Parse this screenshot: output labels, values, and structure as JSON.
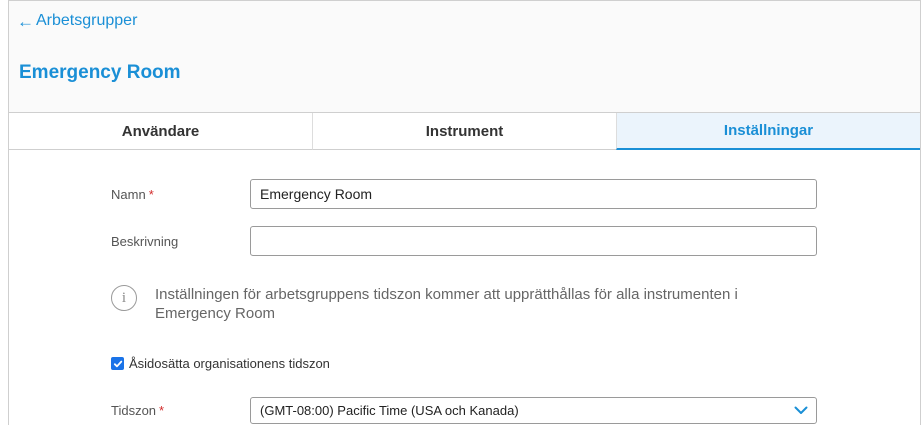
{
  "header": {
    "back_arrow": "←",
    "back_label": "Arbetsgrupper",
    "title": "Emergency Room"
  },
  "tabs": [
    {
      "label": "Användare",
      "active": false
    },
    {
      "label": "Instrument",
      "active": false
    },
    {
      "label": "Inställningar",
      "active": true
    }
  ],
  "form": {
    "name": {
      "label": "Namn",
      "required_mark": "*",
      "value": "Emergency Room"
    },
    "description": {
      "label": "Beskrivning",
      "value": ""
    },
    "info": {
      "icon": "info-icon",
      "glyph": "i",
      "line1": "Inställningen för arbetsgruppens tidszon kommer att upprätthållas för alla instrumenten i",
      "line2": "Emergency Room"
    },
    "override": {
      "label": "Åsidosätta organisationens tidszon",
      "checked": true
    },
    "timezone": {
      "label": "Tidszon",
      "required_mark": "*",
      "value": "(GMT-08:00) Pacific Time (USA och Kanada)",
      "icon": "chevron-down-icon"
    }
  },
  "colors": {
    "accent": "#1a8fd6",
    "active_tab_bg": "#ebf4fc",
    "required": "#d22a2a",
    "checkbox": "#1a73e8"
  }
}
